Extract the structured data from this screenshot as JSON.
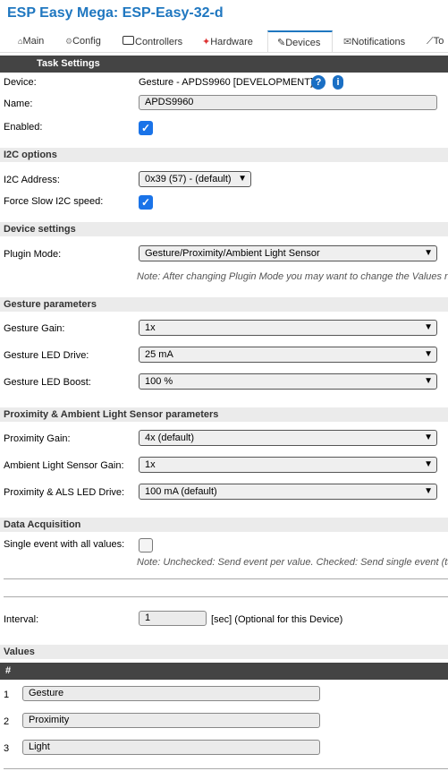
{
  "header": {
    "title": "ESP Easy Mega: ESP-Easy-32-d"
  },
  "tabs": [
    {
      "label": "Main",
      "icon": "home-icon",
      "glyph": "⌂"
    },
    {
      "label": "Config",
      "icon": "gear-icon",
      "glyph": "⚙"
    },
    {
      "label": "Controllers",
      "icon": "chat-icon",
      "glyph": "💬"
    },
    {
      "label": "Hardware",
      "icon": "pin-icon",
      "glyph": "📌"
    },
    {
      "label": "Devices",
      "icon": "plug-icon",
      "glyph": "✎"
    },
    {
      "label": "Notifications",
      "icon": "mail-icon",
      "glyph": "✉"
    },
    {
      "label": "To",
      "icon": "wrench-icon",
      "glyph": "🔧"
    }
  ],
  "task": {
    "header": "Task Settings",
    "device_label": "Device:",
    "device_value": "Gesture - APDS9960 [DEVELOPMENT]",
    "help": "?",
    "info": "i",
    "name_label": "Name:",
    "name_value": "APDS9960",
    "enabled_label": "Enabled:",
    "enabled": true
  },
  "i2c": {
    "title": "I2C options",
    "address_label": "I2C Address:",
    "address_value": "0x39 (57) - (default)",
    "slow_label": "Force Slow I2C speed:",
    "slow": true
  },
  "device_settings": {
    "title": "Device settings",
    "mode_label": "Plugin Mode:",
    "mode_value": "Gesture/Proximity/Ambient Light Sensor",
    "note": "Note: After changing Plugin Mode you may want to change the Values nar"
  },
  "gesture": {
    "title": "Gesture parameters",
    "gain_label": "Gesture Gain:",
    "gain_value": "1x",
    "led_label": "Gesture LED Drive:",
    "led_value": "25 mA",
    "boost_label": "Gesture LED Boost:",
    "boost_value": "100 %"
  },
  "prox": {
    "title": "Proximity & Ambient Light Sensor parameters",
    "gain_label": "Proximity Gain:",
    "gain_value": "4x (default)",
    "als_label": "Ambient Light Sensor Gain:",
    "als_value": "1x",
    "led_label": "Proximity & ALS LED Drive:",
    "led_value": "100 mA (default)"
  },
  "acq": {
    "title": "Data Acquisition",
    "single_label": "Single event with all values:",
    "single": false,
    "note": "Note: Unchecked: Send event per value. Checked: Send single event (tas"
  },
  "interval": {
    "label": "Interval:",
    "value": "1",
    "unit": "[sec] (Optional for this Device)"
  },
  "values": {
    "title": "Values",
    "header": "#",
    "rows": [
      {
        "num": "1",
        "name": "Gesture"
      },
      {
        "num": "2",
        "name": "Proximity"
      },
      {
        "num": "3",
        "name": "Light"
      }
    ]
  }
}
